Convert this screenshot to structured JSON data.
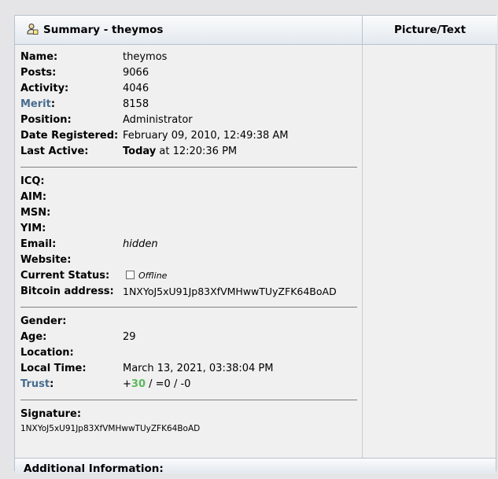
{
  "header": {
    "summary_title": "Summary - theymos",
    "picture_text_title": "Picture/Text",
    "icon": "user-profile-icon"
  },
  "profile": {
    "name": {
      "label": "Name:",
      "value": "theymos"
    },
    "posts": {
      "label": "Posts:",
      "value": "9066"
    },
    "activity": {
      "label": "Activity:",
      "value": "4046"
    },
    "merit": {
      "label": "Merit",
      "colon": ":",
      "value": "8158"
    },
    "position": {
      "label": "Position:",
      "value": "Administrator"
    },
    "date_registered": {
      "label": "Date Registered:",
      "value": "February 09, 2010, 12:49:38 AM"
    },
    "last_active": {
      "label": "Last Active:",
      "value_bold": "Today",
      "value_rest": " at 12:20:36 PM"
    }
  },
  "contact": {
    "icq": {
      "label": "ICQ:"
    },
    "aim": {
      "label": "AIM:"
    },
    "msn": {
      "label": "MSN:"
    },
    "yim": {
      "label": "YIM:"
    },
    "email": {
      "label": "Email:",
      "value": "hidden"
    },
    "website": {
      "label": "Website:"
    },
    "current_status": {
      "label": "Current Status:",
      "value": "Offline"
    },
    "bitcoin_address": {
      "label": "Bitcoin address:",
      "value": "1NXYoJ5xU91Jp83XfVMHwwTUyZFK64BoAD"
    }
  },
  "personal": {
    "gender": {
      "label": "Gender:"
    },
    "age": {
      "label": "Age:",
      "value": "29"
    },
    "location": {
      "label": "Location:"
    },
    "local_time": {
      "label": "Local Time:",
      "value": "March 13, 2021, 03:38:04 PM"
    },
    "trust": {
      "label": "Trust",
      "colon": ":",
      "plus": "+",
      "positive": "30",
      "rest": " / =0 / -0"
    }
  },
  "signature": {
    "label": "Signature:",
    "value": "1NXYoJ5xU91Jp83XfVMHwwTUyZFK64BoAD"
  },
  "footer": {
    "additional_info": "Additional Information:"
  },
  "colors": {
    "link": "#476c8e",
    "trust_positive": "#5cb85c"
  }
}
